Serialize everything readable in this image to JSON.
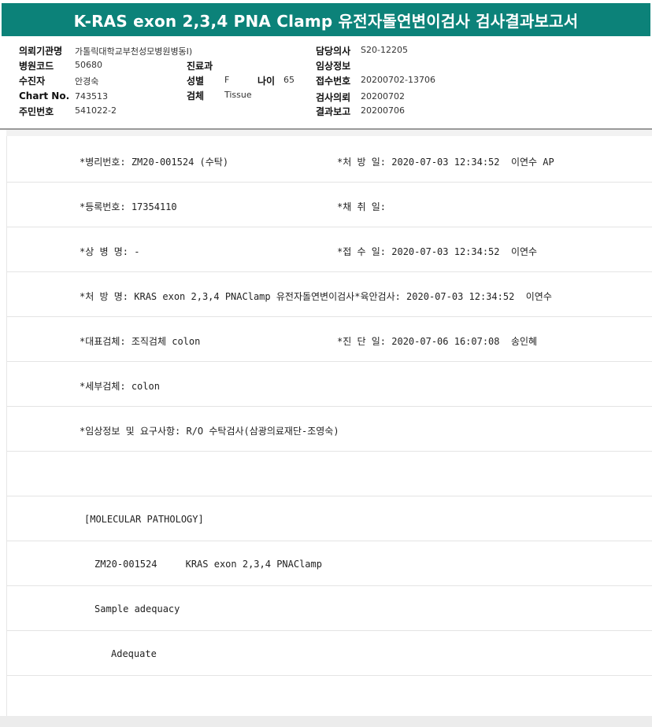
{
  "title": "K-RAS exon 2,3,4 PNA Clamp 유전자돌연변이검사 검사결과보고서",
  "header": {
    "left": [
      {
        "label": "의뢰기관명",
        "value": "가톨릭대학교부천성모병원병동I)"
      },
      {
        "label": "병원코드",
        "value": "50680"
      },
      {
        "label": "수진자",
        "value": "안경숙"
      },
      {
        "label": "Chart No.",
        "value": "743513"
      },
      {
        "label": "주민번호",
        "value": "541022-2"
      }
    ],
    "middle": [
      {
        "label": "진료과",
        "value": ""
      },
      {
        "label": "성별",
        "value": "F"
      },
      {
        "label": "검체",
        "value": "Tissue"
      }
    ],
    "age": {
      "label": "나이",
      "value": "65"
    },
    "right": [
      {
        "label": "담당의사",
        "value": "S20-12205"
      },
      {
        "label": "임상정보",
        "value": ""
      },
      {
        "label": "접수번호",
        "value": "20200702-13706"
      },
      {
        "label": "검사의뢰",
        "value": "20200702"
      },
      {
        "label": "결과보고",
        "value": "20200706"
      }
    ]
  },
  "rows": [
    {
      "left": "*병리번호: ZM20-001524 (수탁)",
      "right": "*처 방 일: 2020-07-03 12:34:52  이연수 AP"
    },
    {
      "left": "*등록번호: 17354110",
      "right": "*채 취 일:"
    },
    {
      "left": "*상 병 명: -",
      "right": "*접 수 일: 2020-07-03 12:34:52  이연수"
    },
    {
      "left": "*처 방 명: KRAS exon 2,3,4 PNAClamp 유전자돌연변이검사*육안검사: 2020-07-03 12:34:52  이연수",
      "right": ""
    },
    {
      "left": "*대표검체: 조직검체 colon",
      "right": "*진 단 일: 2020-07-06 16:07:08  송인혜"
    },
    {
      "left": "*세부검체: colon",
      "right": ""
    },
    {
      "left": "*임상정보 및 요구사항: R/O 수탁검사(삼광의료재단-조영숙)",
      "right": ""
    },
    {
      "left": "",
      "right": ""
    },
    {
      "left": "[MOLECULAR PATHOLOGY]",
      "right": ""
    },
    {
      "left": "ZM20-001524     KRAS exon 2,3,4 PNAClamp",
      "right": ""
    },
    {
      "left": "Sample adequacy",
      "right": ""
    },
    {
      "left": "Adequate",
      "right": ""
    }
  ]
}
